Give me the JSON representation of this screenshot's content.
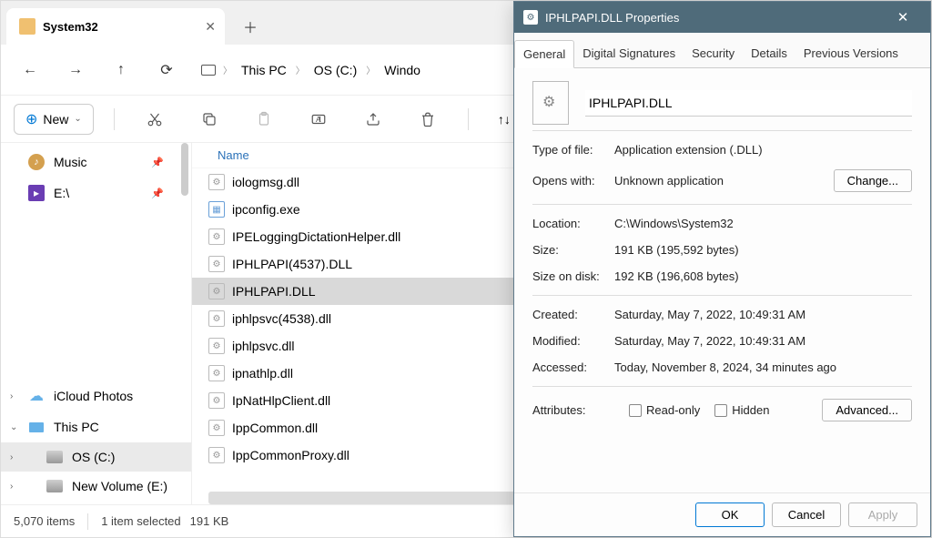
{
  "tab": {
    "title": "System32"
  },
  "breadcrumb": [
    "This PC",
    "OS (C:)",
    "Windo"
  ],
  "toolbar": {
    "new": "New",
    "sort": "Sort"
  },
  "sidebar": {
    "top": [
      {
        "label": "Music",
        "icon": "music"
      },
      {
        "label": "E:\\",
        "icon": "e"
      }
    ],
    "bottom": [
      {
        "label": "iCloud Photos",
        "icon": "cloud",
        "chev": "›"
      },
      {
        "label": "This PC",
        "icon": "pc",
        "chev": "⌄"
      },
      {
        "label": "OS (C:)",
        "icon": "disk",
        "chev": "›",
        "sel": true,
        "indent": true
      },
      {
        "label": "New Volume (E:)",
        "icon": "disk",
        "chev": "›",
        "indent": true
      }
    ]
  },
  "columns": {
    "name": "Name"
  },
  "files": [
    {
      "name": "iologmsg.dll",
      "type": "dll"
    },
    {
      "name": "ipconfig.exe",
      "type": "exe"
    },
    {
      "name": "IPELoggingDictationHelper.dll",
      "type": "dll"
    },
    {
      "name": "IPHLPAPI(4537).DLL",
      "type": "dll"
    },
    {
      "name": "IPHLPAPI.DLL",
      "type": "dll",
      "sel": true
    },
    {
      "name": "iphlpsvc(4538).dll",
      "type": "dll"
    },
    {
      "name": "iphlpsvc.dll",
      "type": "dll"
    },
    {
      "name": "ipnathlp.dll",
      "type": "dll"
    },
    {
      "name": "IpNatHlpClient.dll",
      "type": "dll"
    },
    {
      "name": "IppCommon.dll",
      "type": "dll"
    },
    {
      "name": "IppCommonProxy.dll",
      "type": "dll"
    }
  ],
  "status": {
    "count": "5,070 items",
    "selected": "1 item selected",
    "size": "191 KB"
  },
  "props": {
    "title": "IPHLPAPI.DLL Properties",
    "tabs": [
      "General",
      "Digital Signatures",
      "Security",
      "Details",
      "Previous Versions"
    ],
    "filename": "IPHLPAPI.DLL",
    "typeLabel": "Type of file:",
    "type": "Application extension (.DLL)",
    "opensLabel": "Opens with:",
    "opens": "Unknown application",
    "change": "Change...",
    "locationLabel": "Location:",
    "location": "C:\\Windows\\System32",
    "sizeLabel": "Size:",
    "size": "191 KB (195,592 bytes)",
    "diskLabel": "Size on disk:",
    "disk": "192 KB (196,608 bytes)",
    "createdLabel": "Created:",
    "created": "Saturday, May 7, 2022, 10:49:31 AM",
    "modifiedLabel": "Modified:",
    "modified": "Saturday, May 7, 2022, 10:49:31 AM",
    "accessedLabel": "Accessed:",
    "accessed": "Today, November 8, 2024, 34 minutes ago",
    "attrLabel": "Attributes:",
    "readonly": "Read-only",
    "hidden": "Hidden",
    "advanced": "Advanced...",
    "ok": "OK",
    "cancel": "Cancel",
    "apply": "Apply"
  }
}
